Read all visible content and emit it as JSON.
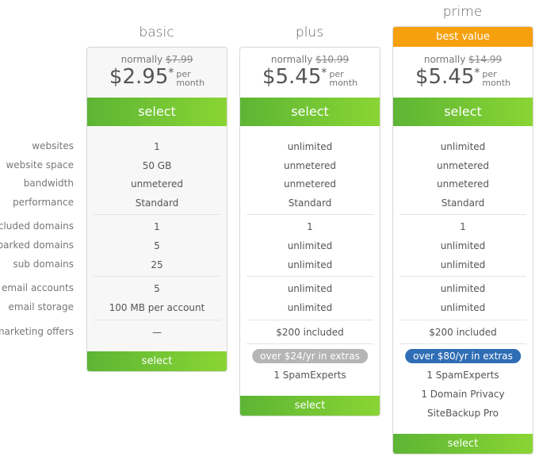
{
  "row_labels": [
    "websites",
    "website space",
    "bandwidth",
    "performance",
    "included domains",
    "parked domains",
    "sub domains",
    "email accounts",
    "email storage",
    "marketing offers"
  ],
  "plans": [
    {
      "name": "basic",
      "normally_label": "normally",
      "old_price": "$7.99",
      "price": "$2.95",
      "asterisk": "*",
      "per": "per",
      "month": "month",
      "select_label": "select",
      "values": [
        "1",
        "50 GB",
        "unmetered",
        "Standard",
        "1",
        "5",
        "25",
        "5",
        "100 MB per account",
        "—"
      ],
      "extras_badge": null,
      "extras": []
    },
    {
      "name": "plus",
      "normally_label": "normally",
      "old_price": "$10.99",
      "price": "$5.45",
      "asterisk": "*",
      "per": "per",
      "month": "month",
      "select_label": "select",
      "values": [
        "unlimited",
        "unmetered",
        "unmetered",
        "Standard",
        "1",
        "unlimited",
        "unlimited",
        "unlimited",
        "unlimited",
        "$200 included"
      ],
      "extras_badge": "over $24/yr in extras",
      "badge_color": "#b5b5b5",
      "extras": [
        "1 SpamExperts"
      ]
    },
    {
      "name": "prime",
      "banner": "best value",
      "normally_label": "normally",
      "old_price": "$14.99",
      "price": "$5.45",
      "asterisk": "*",
      "per": "per",
      "month": "month",
      "select_label": "select",
      "values": [
        "unlimited",
        "unmetered",
        "unmetered",
        "Standard",
        "1",
        "unlimited",
        "unlimited",
        "unlimited",
        "unlimited",
        "$200 included"
      ],
      "extras_badge": "over $80/yr in extras",
      "badge_color": "#2f6db5",
      "extras": [
        "1 SpamExperts",
        "1 Domain Privacy",
        "SiteBackup Pro"
      ]
    }
  ],
  "colors": {
    "select_green": "#6cc334",
    "banner_orange": "#f7a00e"
  }
}
